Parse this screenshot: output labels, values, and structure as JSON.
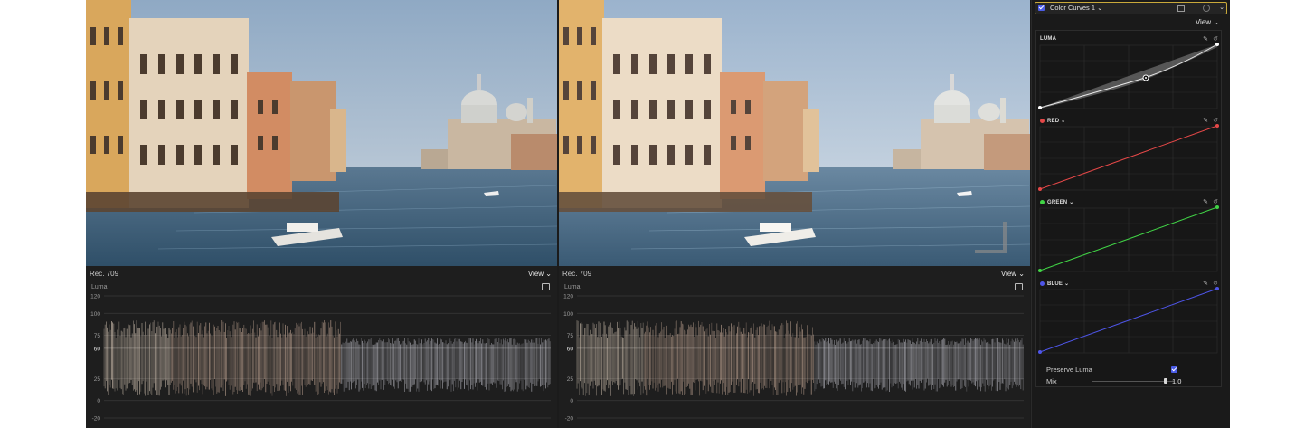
{
  "inspector": {
    "effect_name": "Color Curves 1",
    "view_label": "View",
    "curves": [
      {
        "label": "LUMA",
        "color": "#ffffff"
      },
      {
        "label": "RED",
        "color": "#e54848"
      },
      {
        "label": "GREEN",
        "color": "#41d446"
      },
      {
        "label": "BLUE",
        "color": "#4e55e8"
      }
    ],
    "preserve_luma_label": "Preserve Luma",
    "preserve_luma_checked": true,
    "mix_label": "Mix",
    "mix_value": "1.0",
    "mix_fraction": 0.9,
    "dropdown_chevron": "⌄"
  },
  "scopes": [
    {
      "color_space": "Rec. 709",
      "view_label": "View",
      "scope_type": "Luma",
      "ticks": [
        "120",
        "100",
        "75",
        "60",
        "25",
        "0",
        "-20"
      ]
    },
    {
      "color_space": "Rec. 709",
      "view_label": "View",
      "scope_type": "Luma",
      "ticks": [
        "120",
        "100",
        "75",
        "60",
        "25",
        "0",
        "-20"
      ]
    }
  ],
  "colors": {
    "accent_border": "#c9a93a",
    "checkbox": "#4b5ce6",
    "panel_bg": "#1b1b1b"
  }
}
